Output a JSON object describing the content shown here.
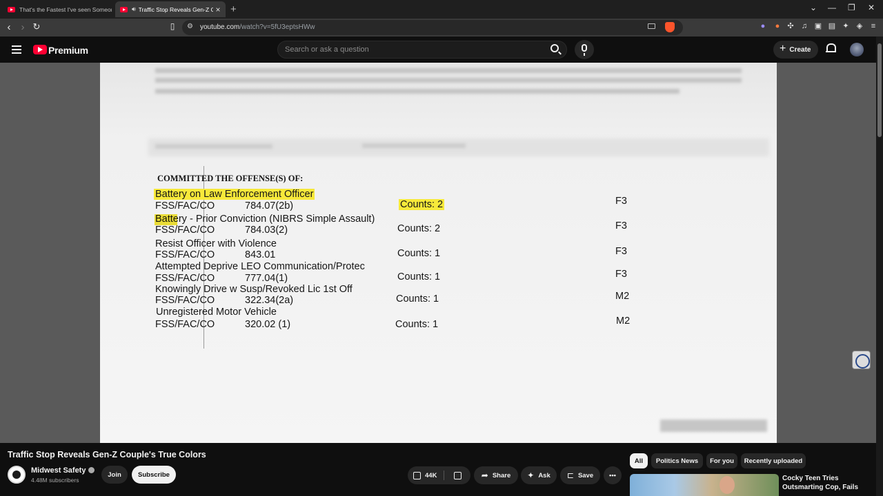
{
  "browser": {
    "tabs": [
      {
        "title": "That's the Fastest I've seen Someone",
        "active": false
      },
      {
        "title": "Traffic Stop Reveals Gen-Z Co",
        "active": true
      }
    ],
    "url_host": "youtube.com",
    "url_path": "/watch?v=5fU3eptsHWw"
  },
  "youtube": {
    "brand": "Premium",
    "search_placeholder": "Search or ask a question",
    "create_label": "Create"
  },
  "document": {
    "heading": "COMMITTED THE OFFENSE(S) OF:",
    "charges": [
      {
        "offense": "Battery on Law Enforcement Officer",
        "code_label": "FSS/FAC/CO",
        "statute": "784.07(2b)",
        "counts": "Counts: 2",
        "degree": "F3"
      },
      {
        "offense": "Battery - Prior Conviction (NIBRS Simple Assault)",
        "code_label": "FSS/FAC/CO",
        "statute": "784.03(2)",
        "counts": "Counts: 2",
        "degree": "F3"
      },
      {
        "offense": "Resist Officer with Violence",
        "code_label": "FSS/FAC/CO",
        "statute": "843.01",
        "counts": "Counts: 1",
        "degree": "F3"
      },
      {
        "offense": "Attempted Deprive LEO Communication/Protec",
        "code_label": "FSS/FAC/CO",
        "statute": "777.04(1)",
        "counts": "Counts: 1",
        "degree": "F3"
      },
      {
        "offense": "Knowingly Drive w Susp/Revoked Lic 1st Off",
        "code_label": "FSS/FAC/CO",
        "statute": "322.34(2a)",
        "counts": "Counts: 1",
        "degree": "M2"
      },
      {
        "offense": "Unregistered Motor Vehicle",
        "code_label": "FSS/FAC/CO",
        "statute": "320.02 (1)",
        "counts": "Counts: 1",
        "degree": "M2"
      }
    ],
    "highlight_color": "#f7e93a"
  },
  "video": {
    "title": "Traffic Stop Reveals Gen-Z Couple's True Colors",
    "channel": "Midwest Safety",
    "subscribers": "4.48M subscribers",
    "join_label": "Join",
    "subscribe_label": "Subscribe",
    "likes": "44K",
    "share_label": "Share",
    "ask_label": "Ask",
    "save_label": "Save"
  },
  "sidebar": {
    "chips": [
      "All",
      "Politics News",
      "For you",
      "Recently uploaded"
    ],
    "active_chip": "All",
    "recommendation_title": "Cocky Teen Tries Outsmarting Cop, Fails"
  },
  "colors": {
    "youtube_red": "#ff0033",
    "background": "#0f0f0f"
  }
}
